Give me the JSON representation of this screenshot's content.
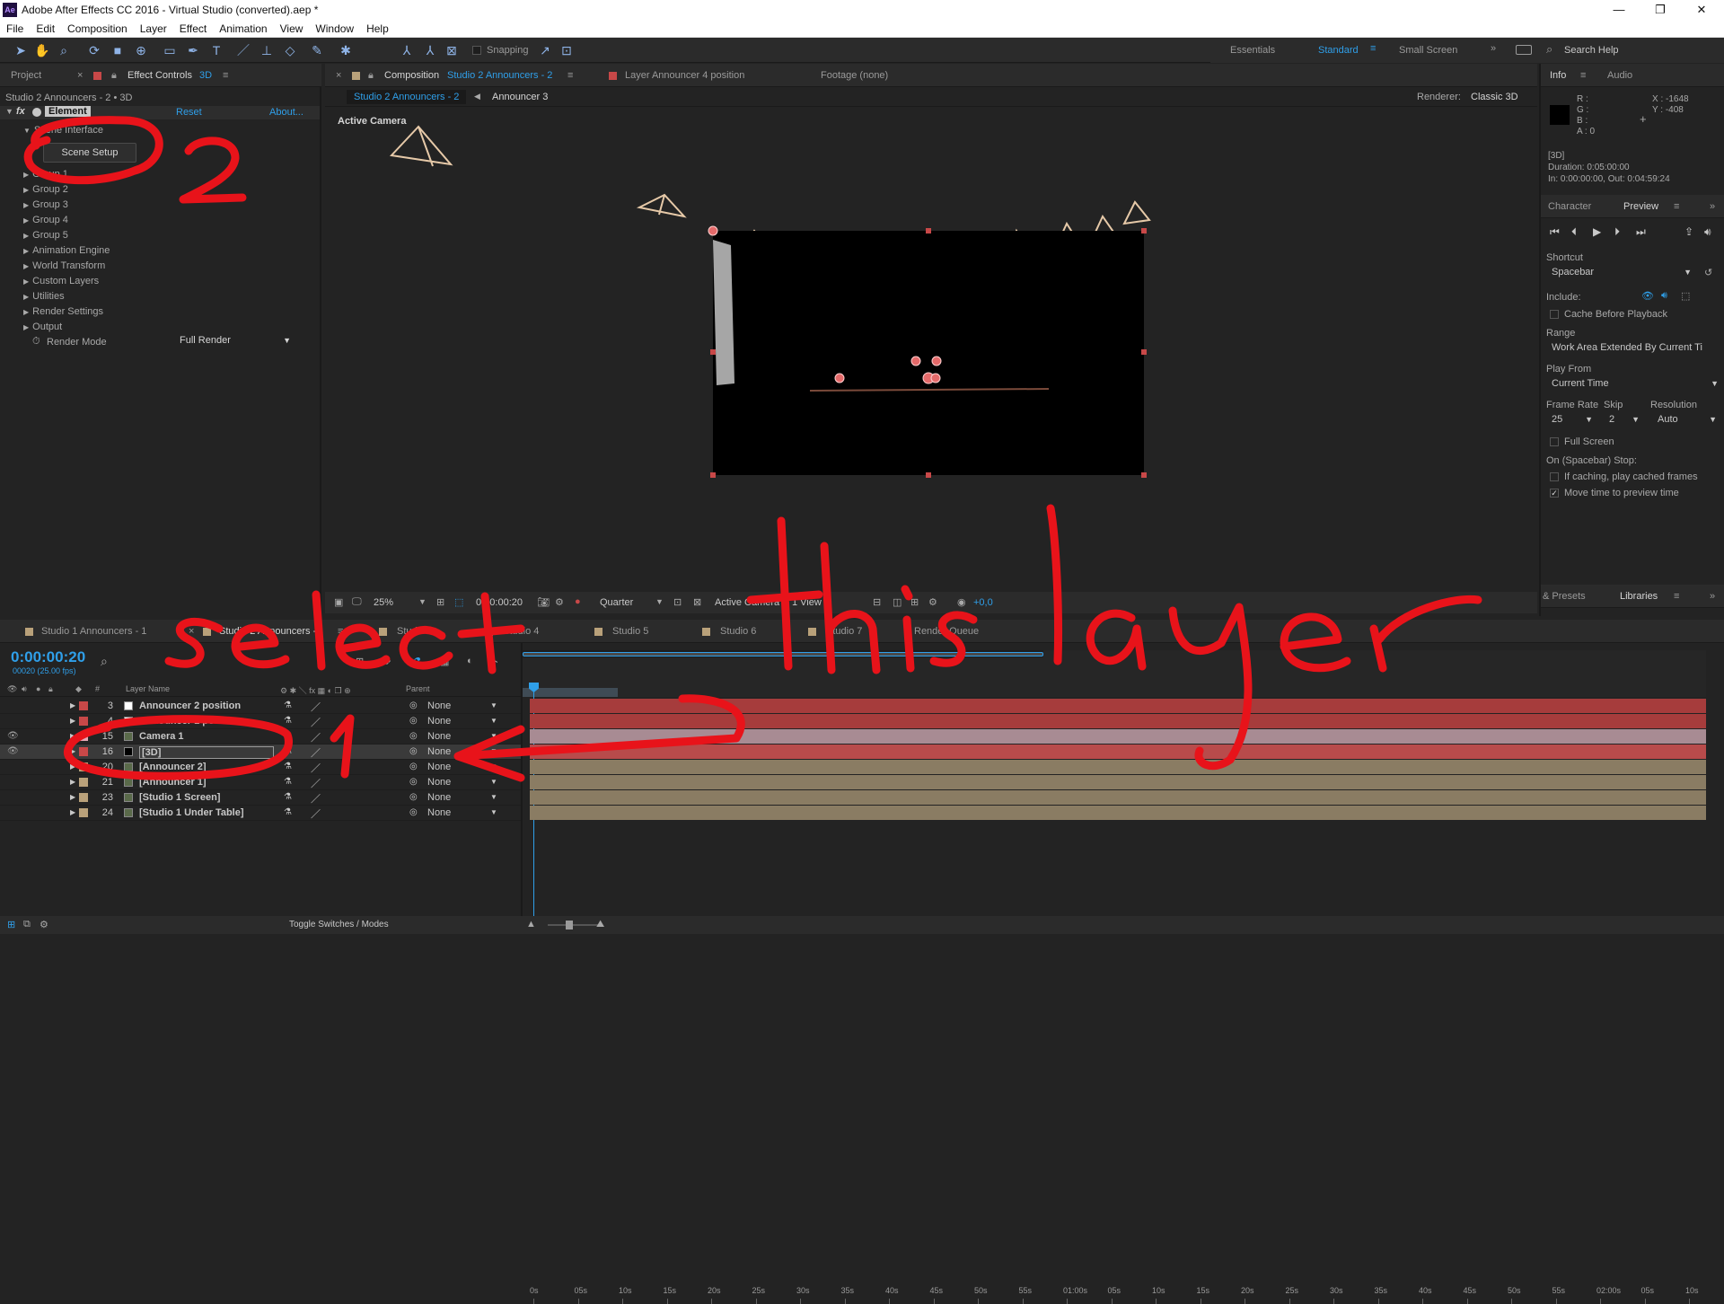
{
  "window": {
    "title": "Adobe After Effects CC 2016 - Virtual Studio (converted).aep *",
    "app_icon": "Ae",
    "controls": [
      "—",
      "❐",
      "✕"
    ]
  },
  "menu": [
    "File",
    "Edit",
    "Composition",
    "Layer",
    "Effect",
    "Animation",
    "View",
    "Window",
    "Help"
  ],
  "toolbar": {
    "snapping": "Snapping",
    "workspaces": [
      "Essentials",
      "Standard",
      "Small Screen"
    ],
    "search": "Search Help"
  },
  "left_panel": {
    "tab_project": "Project",
    "tab_effect_controls": "Effect Controls",
    "tab_effect_controls_layer": "3D",
    "breadcrumb": "Studio 2 Announcers - 2 • 3D",
    "effect_name": "Element",
    "reset": "Reset",
    "about": "About...",
    "scene_interface": "Scene Interface",
    "scene_setup_button": "Scene Setup",
    "groups": [
      "Group 1",
      "Group 2",
      "Group 3",
      "Group 4",
      "Group 5",
      "Animation Engine",
      "World Transform",
      "Custom Layers",
      "Utilities",
      "Render Settings",
      "Output"
    ],
    "render_mode_label": "Render Mode",
    "render_mode_value": "Full Render"
  },
  "comp_panel": {
    "tab_composition_prefix": "Composition",
    "tab_composition_name": "Studio 2 Announcers - 2",
    "tab_layer": "Layer  Announcer 4 position",
    "tab_footage": "Footage  (none)",
    "subtab_active": "Studio 2 Announcers - 2",
    "subtab_next": "Announcer 3",
    "renderer_label": "Renderer:",
    "renderer_value": "Classic 3D",
    "viewer_label": "Active Camera",
    "zoom": "25%",
    "timecode": "0:00:00:20",
    "resolution": "Quarter",
    "camera_view": "Active Camera",
    "view_count": "1 View",
    "exposure": "+0,0"
  },
  "right_panel": {
    "tab_info": "Info",
    "tab_audio": "Audio",
    "rgba": [
      "R :",
      "G :",
      "B :",
      "A : 0"
    ],
    "xy": [
      "X : -1648",
      "Y : -408"
    ],
    "info_lines": [
      "[3D]",
      "Duration: 0:05:00:00",
      "In: 0:00:00:00, Out: 0:04:59:24"
    ],
    "tab_character": "Character",
    "tab_preview": "Preview",
    "shortcut_label": "Shortcut",
    "shortcut_value": "Spacebar",
    "include_label": "Include:",
    "cache_before_playback": "Cache Before Playback",
    "range_label": "Range",
    "range_value": "Work Area Extended By Current Ti",
    "play_from_label": "Play From",
    "play_from_value": "Current Time",
    "frame_rate_label": "Frame Rate",
    "skip_label": "Skip",
    "resolution_label": "Resolution",
    "frame_rate_value": "25",
    "skip_value": "2",
    "resolution_value": "Auto",
    "full_screen": "Full Screen",
    "on_stop_label": "On (Spacebar) Stop:",
    "if_caching": "If caching, play cached frames",
    "move_time": "Move time to preview time",
    "tab_presets": "& Presets",
    "tab_libraries": "Libraries"
  },
  "timeline": {
    "tabs": [
      "Studio 1 Announcers - 1",
      "Studio 2 Announcers -",
      "Studio 3",
      "Studio 4",
      "Studio 5",
      "Studio 6",
      "Studio 7",
      "Render Queue"
    ],
    "timecode": "0:00:00:20",
    "frame_info": "00020 (25.00 fps)",
    "col_layer_name": "Layer Name",
    "col_parent": "Parent",
    "col_hash": "#",
    "ruler": [
      "0s",
      "05s",
      "10s",
      "15s",
      "20s",
      "25s",
      "30s",
      "35s",
      "40s",
      "45s",
      "50s",
      "55s",
      "01:00s",
      "05s",
      "10s",
      "15s",
      "20s",
      "25s",
      "30s",
      "35s",
      "40s",
      "45s",
      "50s",
      "55s",
      "02:00s",
      "05s",
      "10s"
    ],
    "layers": [
      {
        "num": "3",
        "name": "Announcer 2 position",
        "parent": "None",
        "color": "#c84848",
        "bar": "#a63c3c"
      },
      {
        "num": "4",
        "name": "Announcer 1 position",
        "parent": "None",
        "color": "#c84848",
        "bar": "#a63c3c"
      },
      {
        "num": "15",
        "name": "Camera 1",
        "parent": "None",
        "color": "#e6a9b6",
        "bar": "#a88b93"
      },
      {
        "num": "16",
        "name": "[3D]",
        "parent": "None",
        "color": "#c84848",
        "bar": "#b84b4b"
      },
      {
        "num": "20",
        "name": "[Announcer 2]",
        "parent": "None",
        "color": "#b9a17a",
        "bar": "#8a7c63"
      },
      {
        "num": "21",
        "name": "[Announcer 1]",
        "parent": "None",
        "color": "#b9a17a",
        "bar": "#8a7c63"
      },
      {
        "num": "23",
        "name": "[Studio 1 Screen]",
        "parent": "None",
        "color": "#b9a17a",
        "bar": "#8a7c63"
      },
      {
        "num": "24",
        "name": "[Studio 1 Under Table]",
        "parent": "None",
        "color": "#b9a17a",
        "bar": "#8a7c63"
      }
    ],
    "toggle": "Toggle Switches / Modes"
  },
  "annotations": {
    "handwritten": "select this layer",
    "number_1": "1",
    "number_2": "2"
  },
  "colors": {
    "accent_blue": "#2f9fe9",
    "annotation_red": "#e8131a",
    "panel_bg": "#232323"
  }
}
